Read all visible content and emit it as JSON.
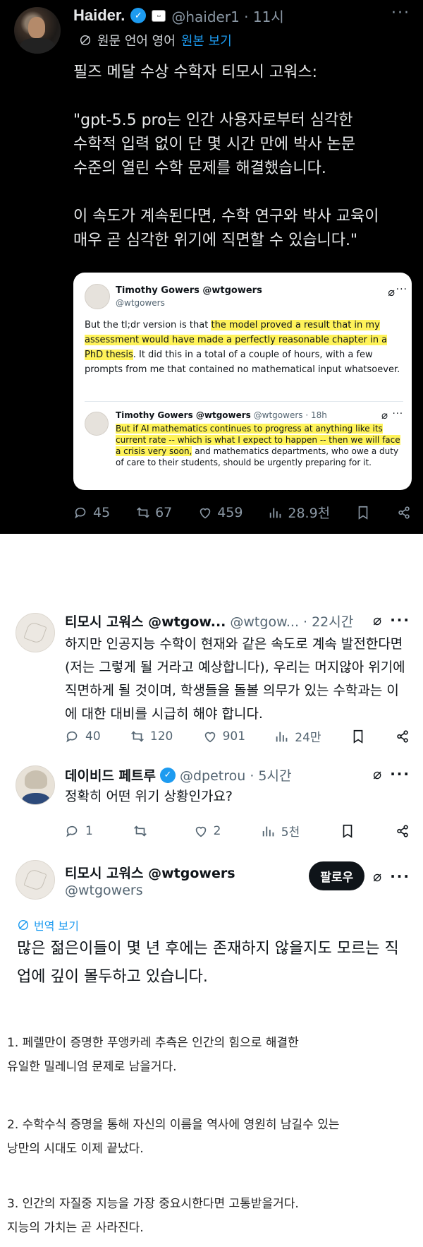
{
  "main_tweet": {
    "name": "Haider.",
    "handle": "@haider1 · 11시",
    "translate_label": "원문 언어 영어",
    "translate_link": "원본 보기",
    "text": "필즈 메달 수상 수학자 티모시 고워스:\n\n\"gpt-5.5 pro는 인간 사용자로부터 심각한\n수학적 입력 없이 단 몇 시간 만에 박사 논문\n수준의 열린 수학 문제를 해결했습니다.\n\n이 속도가 계속된다면, 수학 연구와 박사 교육이\n매우 곧 심각한 위기에 직면할 수 있습니다.\"",
    "quote": {
      "name": "Timothy Gowers @wtgowers",
      "handle": "@wtgowers",
      "body_pre": "But the tl;dr version is that ",
      "body_highlight": "the model proved a result that in my assessment would have made a perfectly reasonable chapter in a PhD thesis",
      "body_post": ". It did this in a total of a couple of hours, with a few prompts from me that contained no mathematical input whatsoever.",
      "inner_name": "Timothy Gowers @wtgowers",
      "inner_meta": "@wtgowers · 18h",
      "inner_highlight": "But if AI mathematics continues to progress at anything like its current rate -- which is what I expect to happen -- then we will face a crisis very soon,",
      "inner_post": " and mathematics departments, who owe a duty of care to their students, should be urgently preparing for it."
    },
    "stats": {
      "replies": "45",
      "reposts": "67",
      "likes": "459",
      "views": "28.9천"
    }
  },
  "replies": [
    {
      "name": "티모시 고워스 @wtgow...",
      "meta": "@wtgow... · 22시간",
      "text": "하지만 인공지능 수학이 현재와 같은 속도로 계속 발전한다면 (저는 그렇게 될 거라고 예상합니다), 우리는 머지않아 위기에 직면하게 될 것이며, 학생들을 돌볼 의무가 있는 수학과는 이에 대한 대비를 시급히 해야 합니다.",
      "stats": {
        "replies": "40",
        "reposts": "120",
        "likes": "901",
        "views": "24만"
      }
    },
    {
      "name": "데이비드 페트루",
      "meta": "@dpetrou · 5시간",
      "text": "정확히 어떤 위기 상황인가요?",
      "stats": {
        "replies": "1",
        "reposts": "",
        "likes": "2",
        "views": "5천"
      }
    },
    {
      "name": "티모시 고워스 @wtgowers",
      "meta": "@wtgowers",
      "follow_label": "팔로우",
      "translate_label": "번역 보기",
      "text": "많은 젊은이들이 몇 년 후에는 존재하지 않을지도 모르는 직업에 깊이 몰두하고 있습니다."
    }
  ],
  "notes": [
    "1. 페렐만이 증명한 푸앵카레 추측은 인간의 힘으로 해결한\n 유일한 밀레니엄 문제로 남을거다.",
    "2. 수학수식 증명을 통해 자신의 이름을 역사에 영원히 남길수 있는\n낭만의 시대도 이제 끝났다.",
    "3. 인간의 자질중 지능을 가장 중요시한다면 고통받을거다.\n지능의 가치는 곧 사라진다."
  ],
  "colors": {
    "accent": "#1d9bf0",
    "highlight": "#fff35a",
    "dark_bg": "#000000"
  }
}
